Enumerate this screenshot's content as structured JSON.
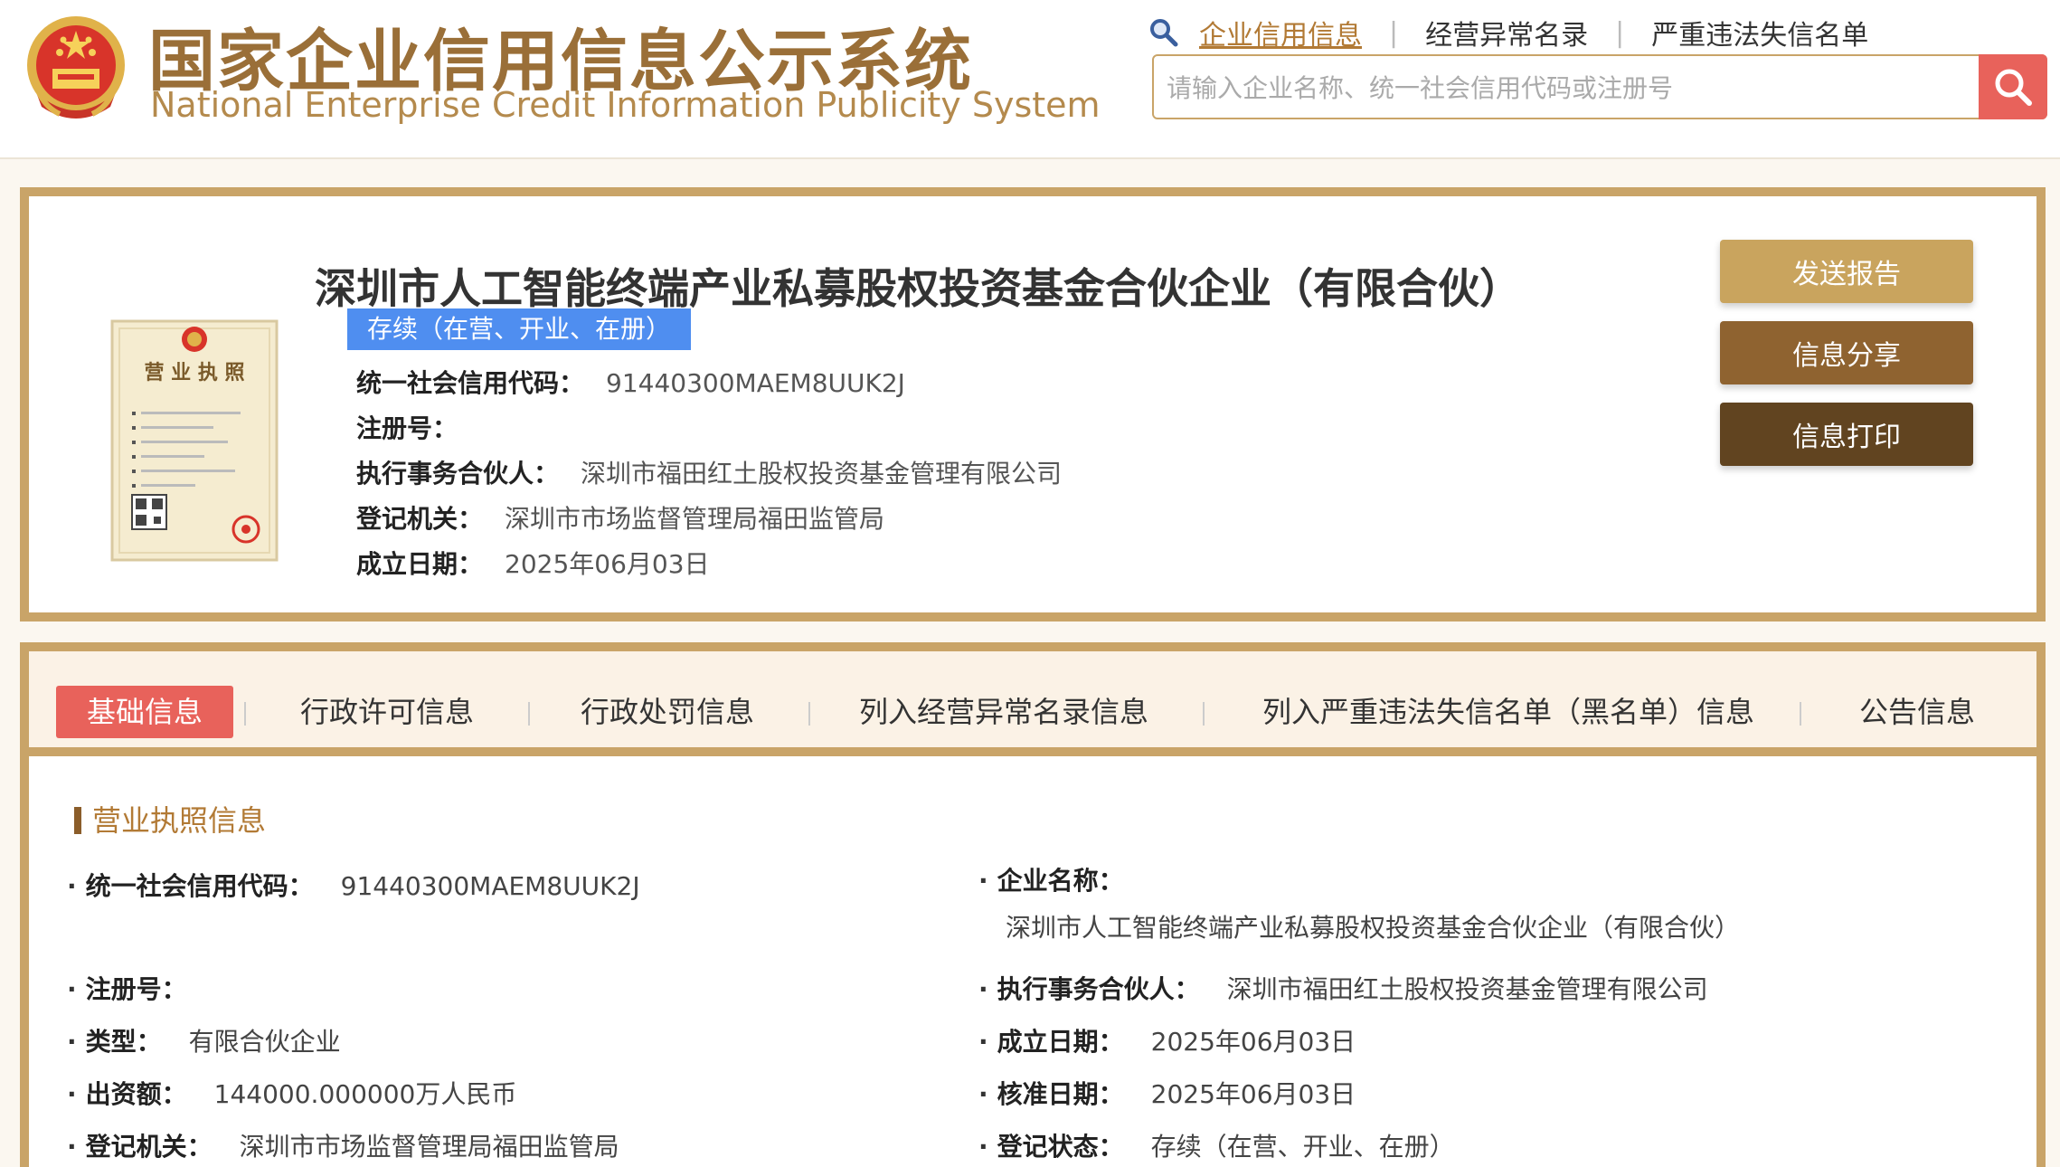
{
  "header": {
    "brand_cn": "国家企业信用信息公示系统",
    "brand_en": "National Enterprise Credit Information Publicity System",
    "nav": [
      "企业信用信息",
      "经营异常名录",
      "严重违法失信名单"
    ],
    "nav_separator": "|",
    "search_placeholder": "请输入企业名称、统一社会信用代码或注册号"
  },
  "company": {
    "name": "深圳市人工智能终端产业私募股权投资基金合伙企业（有限合伙）",
    "status": "存续（在营、开业、在册）",
    "summary": [
      {
        "label": "统一社会信用代码：",
        "value": "91440300MAEM8UUK2J"
      },
      {
        "label": "注册号：",
        "value": ""
      },
      {
        "label": "执行事务合伙人：",
        "value": "深圳市福田红土股权投资基金管理有限公司"
      },
      {
        "label": "登记机关：",
        "value": "深圳市市场监督管理局福田监管局"
      },
      {
        "label": "成立日期：",
        "value": "2025年06月03日"
      }
    ],
    "license_image_text": "营业执照"
  },
  "actions": {
    "send_report": "发送报告",
    "share": "信息分享",
    "print": "信息打印"
  },
  "tabs": [
    "基础信息",
    "行政许可信息",
    "行政处罚信息",
    "列入经营异常名录信息",
    "列入严重违法失信名单（黑名单）信息",
    "公告信息"
  ],
  "license_section": {
    "title": "营业执照信息",
    "bullet": "·",
    "left": [
      {
        "label": "统一社会信用代码：",
        "value": "91440300MAEM8UUK2J"
      },
      {
        "label": "注册号：",
        "value": ""
      },
      {
        "label": "类型：",
        "value": "有限合伙企业"
      },
      {
        "label": "出资额：",
        "value": "144000.000000万人民币"
      },
      {
        "label": "登记机关：",
        "value": "深圳市市场监督管理局福田监管局"
      }
    ],
    "right": [
      {
        "label": "企业名称：",
        "value": "深圳市人工智能终端产业私募股权投资基金合伙企业（有限合伙）"
      },
      {
        "label": "执行事务合伙人：",
        "value": "深圳市福田红土股权投资基金管理有限公司"
      },
      {
        "label": "成立日期：",
        "value": "2025年06月03日"
      },
      {
        "label": "核准日期：",
        "value": "2025年06月03日"
      },
      {
        "label": "登记状态：",
        "value": "存续（在营、开业、在册）"
      }
    ]
  },
  "colors": {
    "gold_border": "#c9a468",
    "active_tab": "#e8625b",
    "status_badge": "#4f8ef0",
    "send_report_btn": "#c9a45e",
    "share_btn": "#8f6330",
    "print_btn": "#614420"
  }
}
